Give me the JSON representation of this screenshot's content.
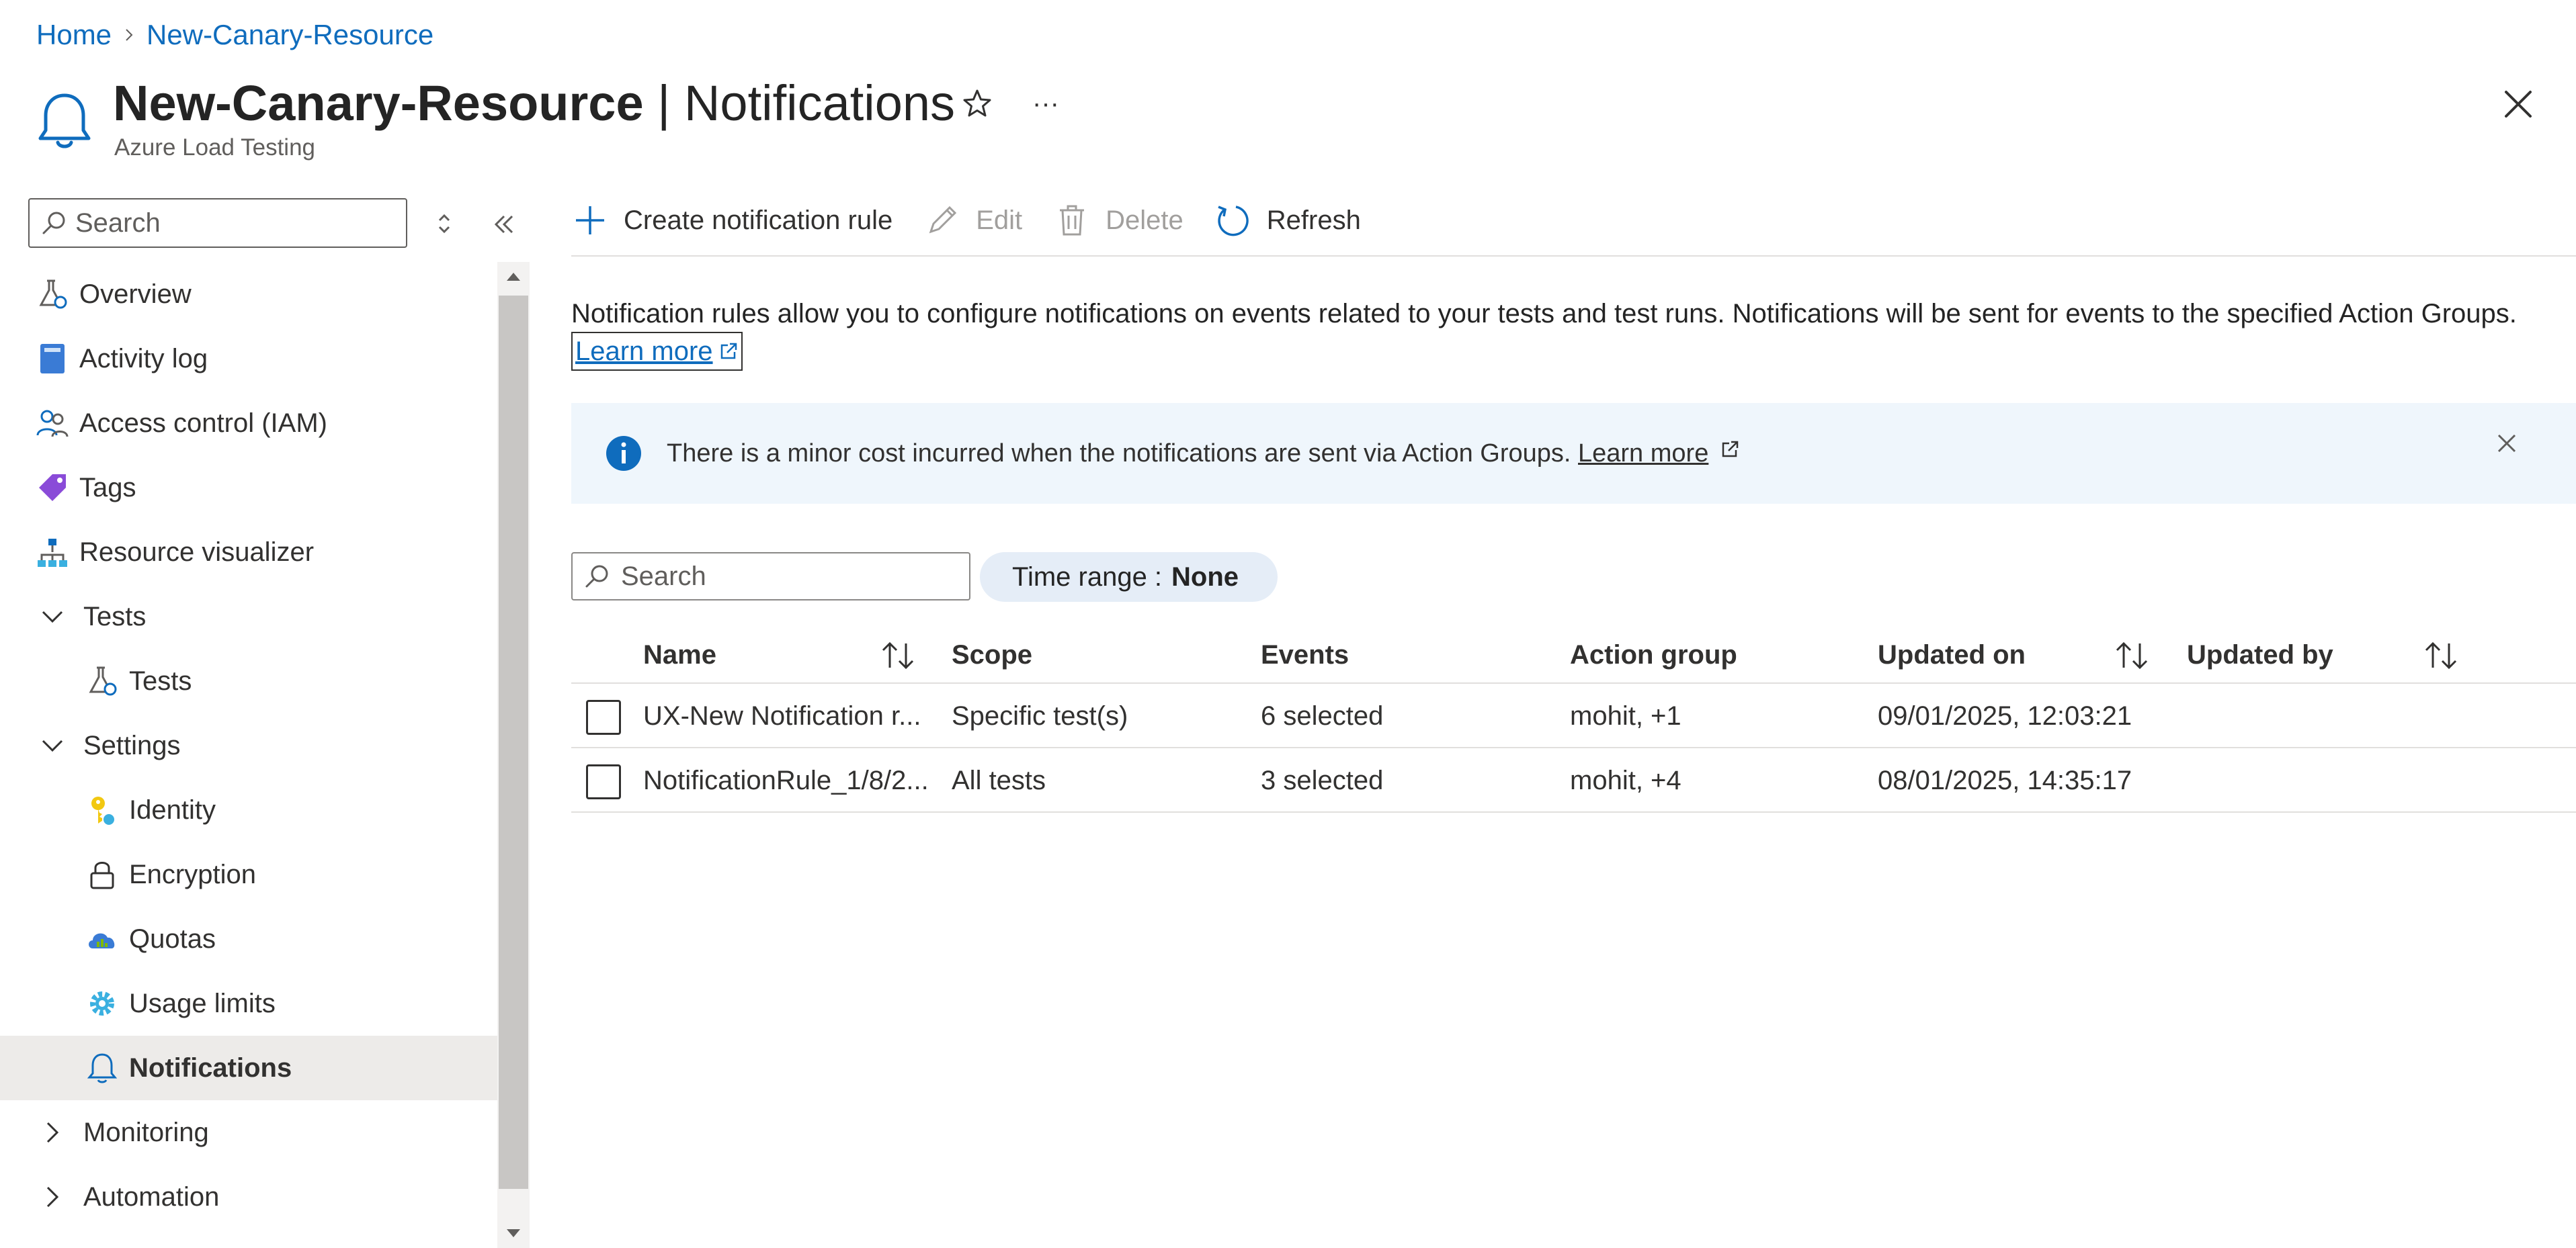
{
  "breadcrumb": {
    "home": "Home",
    "resource": "New-Canary-Resource"
  },
  "header": {
    "resource_name": "New-Canary-Resource",
    "separator": " | ",
    "page_name": "Notifications",
    "subtitle": "Azure Load Testing",
    "more_label": "···"
  },
  "sidebar": {
    "search_placeholder": "Search",
    "items": [
      {
        "label": "Overview",
        "icon": "flask-icon",
        "indent": 0
      },
      {
        "label": "Activity log",
        "icon": "book-icon",
        "indent": 0
      },
      {
        "label": "Access control (IAM)",
        "icon": "people-icon",
        "indent": 0
      },
      {
        "label": "Tags",
        "icon": "tag-icon",
        "indent": 0
      },
      {
        "label": "Resource visualizer",
        "icon": "hierarchy-icon",
        "indent": 0
      },
      {
        "label": "Tests",
        "icon": "chevron-down-icon",
        "indent": 0,
        "expanded": true
      },
      {
        "label": "Tests",
        "icon": "flask-icon",
        "indent": 1
      },
      {
        "label": "Settings",
        "icon": "chevron-down-icon",
        "indent": 0,
        "expanded": true
      },
      {
        "label": "Identity",
        "icon": "key-icon",
        "indent": 1
      },
      {
        "label": "Encryption",
        "icon": "lock-icon",
        "indent": 1
      },
      {
        "label": "Quotas",
        "icon": "cloud-gauge-icon",
        "indent": 1
      },
      {
        "label": "Usage limits",
        "icon": "gear-icon",
        "indent": 1
      },
      {
        "label": "Notifications",
        "icon": "bell-icon",
        "indent": 1,
        "selected": true
      },
      {
        "label": "Monitoring",
        "icon": "chevron-right-icon",
        "indent": 0,
        "expanded": false
      },
      {
        "label": "Automation",
        "icon": "chevron-right-icon",
        "indent": 0,
        "expanded": false
      }
    ]
  },
  "toolbar": {
    "create_label": "Create notification rule",
    "edit_label": "Edit",
    "delete_label": "Delete",
    "refresh_label": "Refresh"
  },
  "description": {
    "text": "Notification rules allow you to configure notifications on events related to your tests and test runs. Notifications will be sent for events to the specified Action Groups.",
    "learn_more": "Learn more"
  },
  "banner": {
    "text": "There is a minor cost incurred when the notifications are sent via Action Groups.",
    "learn_more": "Learn more"
  },
  "filter": {
    "search_placeholder": "Search",
    "time_range_label": "Time range :",
    "time_range_value": "None"
  },
  "table": {
    "columns": [
      "Name",
      "Scope",
      "Events",
      "Action group",
      "Updated on",
      "Updated by"
    ],
    "rows": [
      {
        "name": "UX-New Notification r...",
        "scope": "Specific test(s)",
        "events": "6 selected",
        "action_group": "mohit, +1",
        "updated_on": "09/01/2025, 12:03:21",
        "updated_by": ""
      },
      {
        "name": "NotificationRule_1/8/2...",
        "scope": "All tests",
        "events": "3 selected",
        "action_group": "mohit, +4",
        "updated_on": "08/01/2025, 14:35:17",
        "updated_by": ""
      }
    ]
  },
  "colors": {
    "accent": "#0f6cbd",
    "banner_bg": "#eff6fc",
    "selected_bg": "#edebe9",
    "pill_bg": "#e5edf7"
  }
}
